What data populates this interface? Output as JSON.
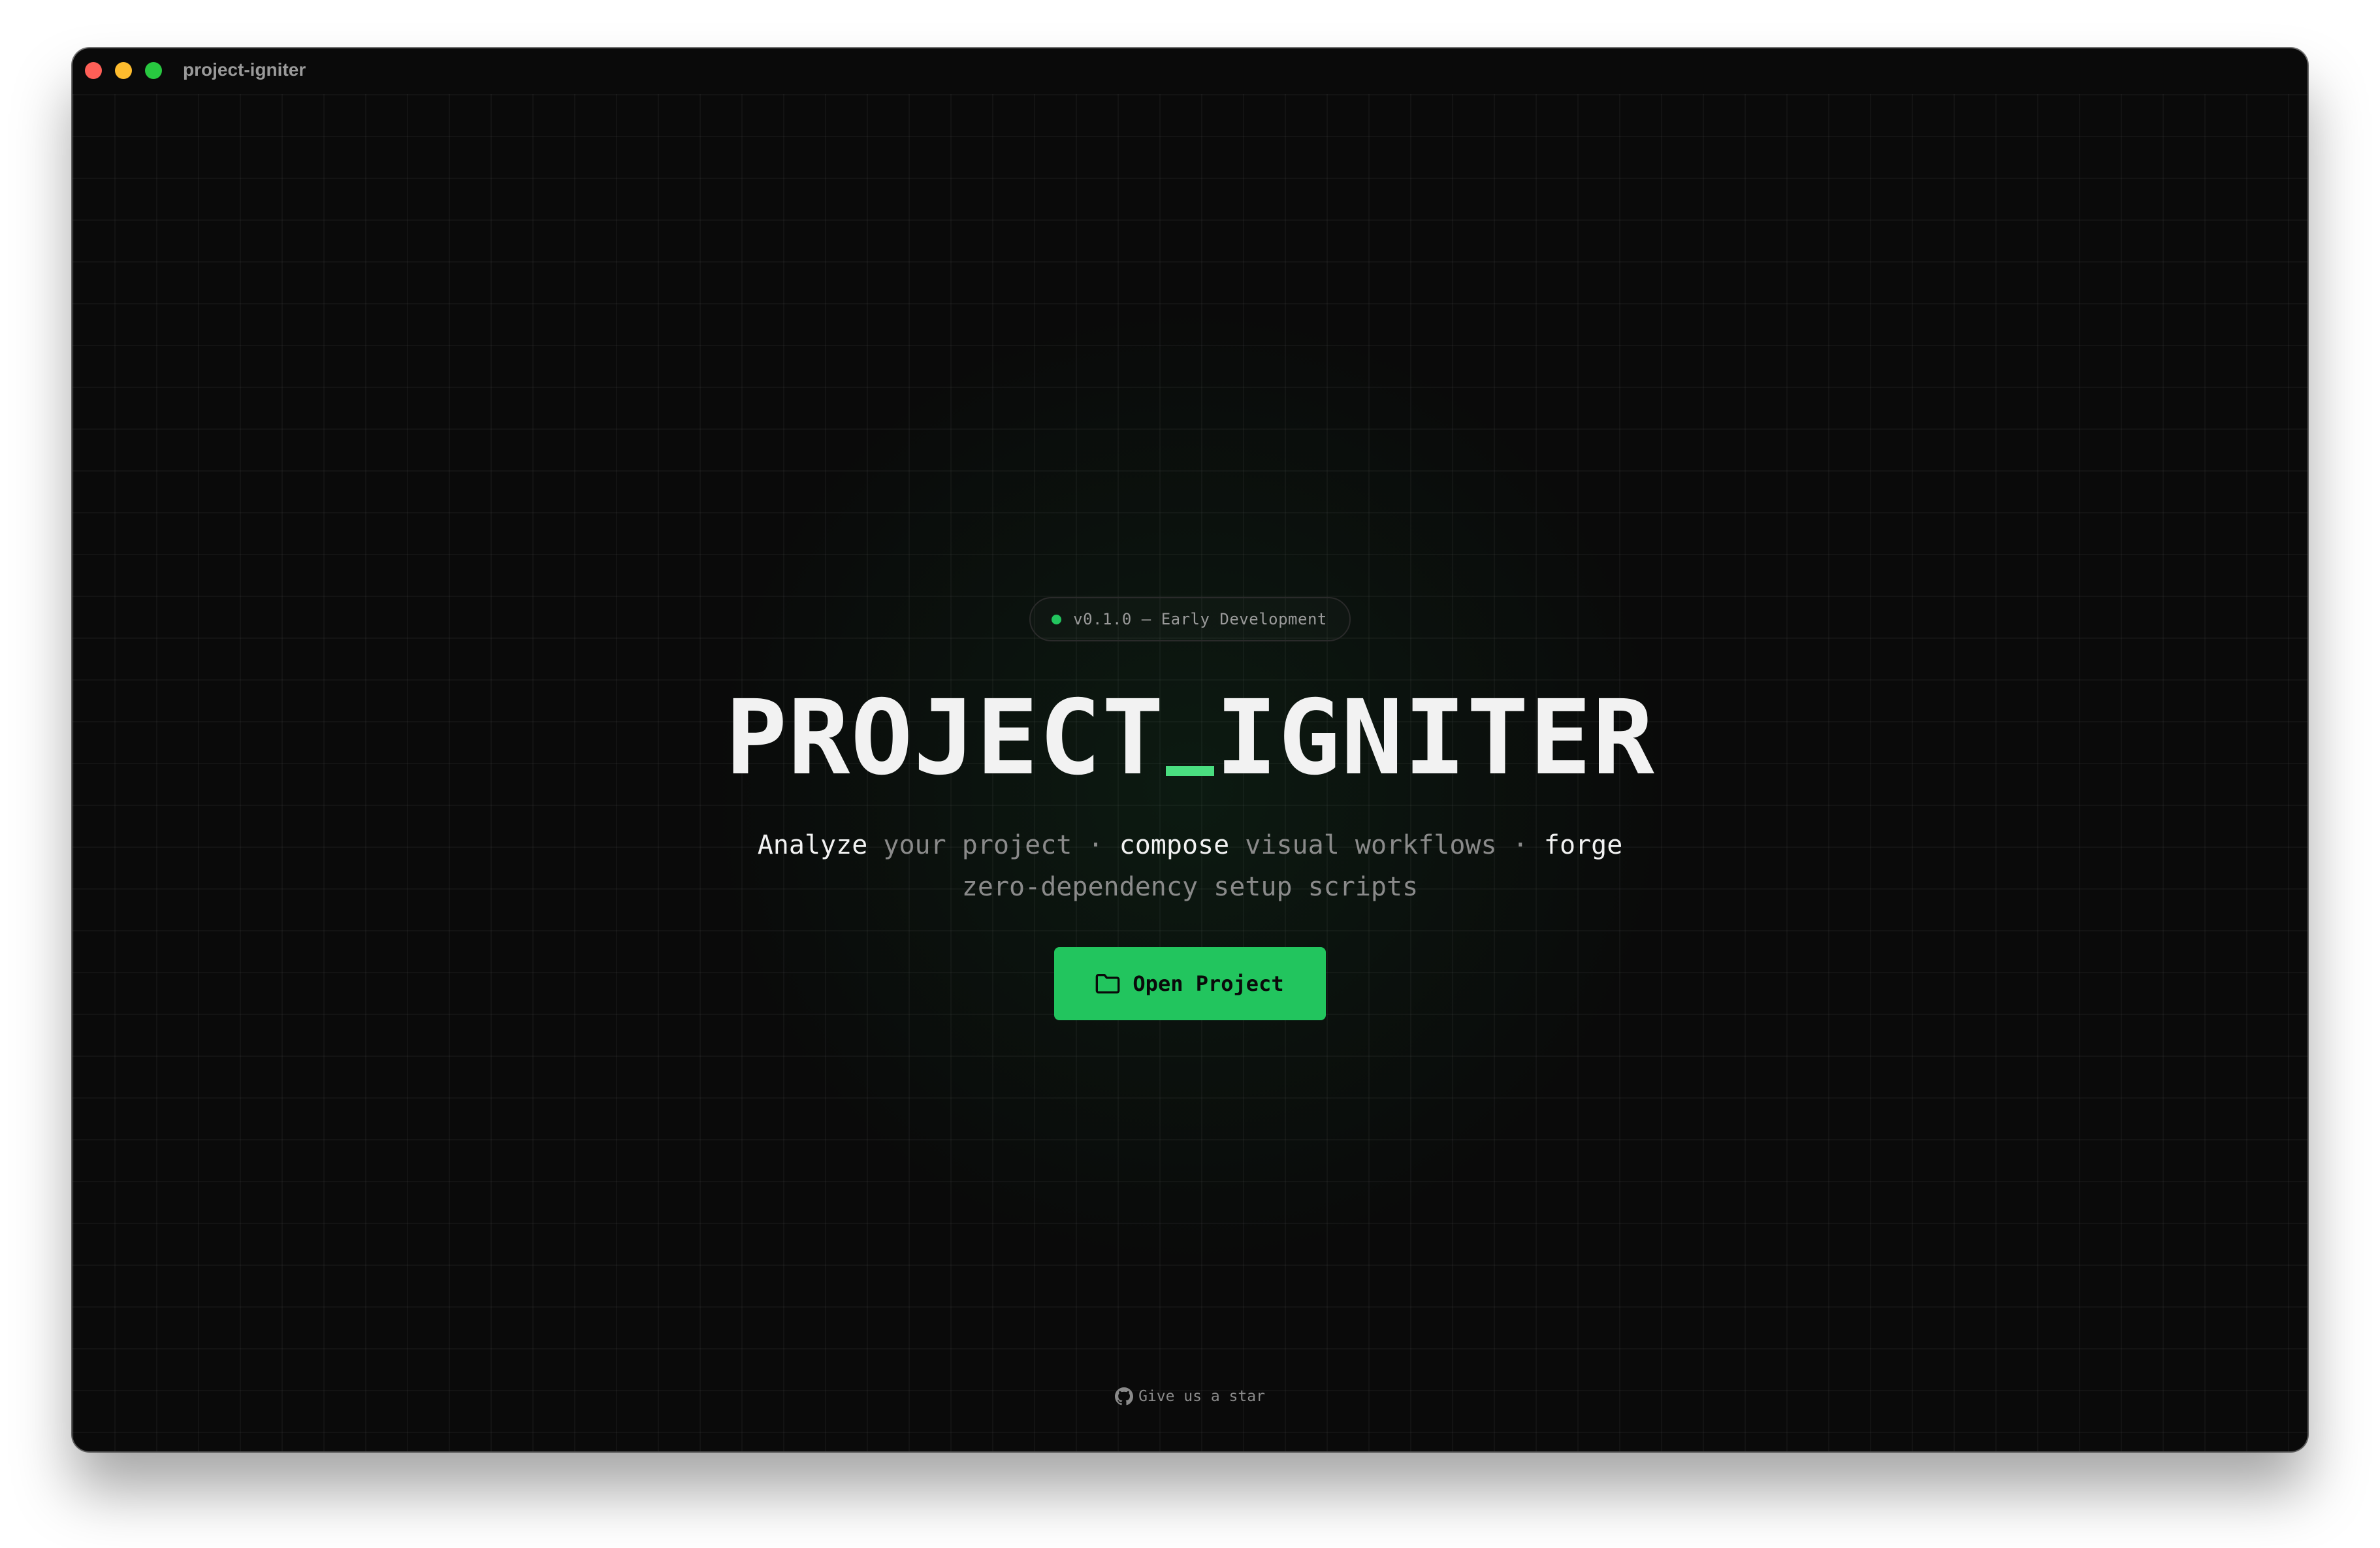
{
  "window": {
    "title": "project-igniter"
  },
  "hero": {
    "badge": "v0.1.0 — Early Development",
    "title_part1": "PROJECT",
    "title_part2": "IGNITER",
    "tagline": {
      "line1": [
        {
          "text": "Analyze",
          "emphasis": true
        },
        {
          "text": " your project ",
          "emphasis": false
        },
        {
          "text": "·",
          "emphasis": false
        },
        {
          "text": " compose",
          "emphasis": true
        },
        {
          "text": " visual workflows ",
          "emphasis": false
        },
        {
          "text": "·",
          "emphasis": false
        },
        {
          "text": " forge",
          "emphasis": true
        }
      ],
      "line2": "zero-dependency setup scripts"
    },
    "cta_label": "Open Project",
    "cta_icon": "folder-icon"
  },
  "footer": {
    "link_label": "Give us a star",
    "link_icon": "github-icon"
  },
  "colors": {
    "accent": "#22c55e",
    "accent_light": "#4ade80",
    "background": "#0a0a0a",
    "text": "#f2f2f2",
    "muted": "#8a8a8a"
  }
}
